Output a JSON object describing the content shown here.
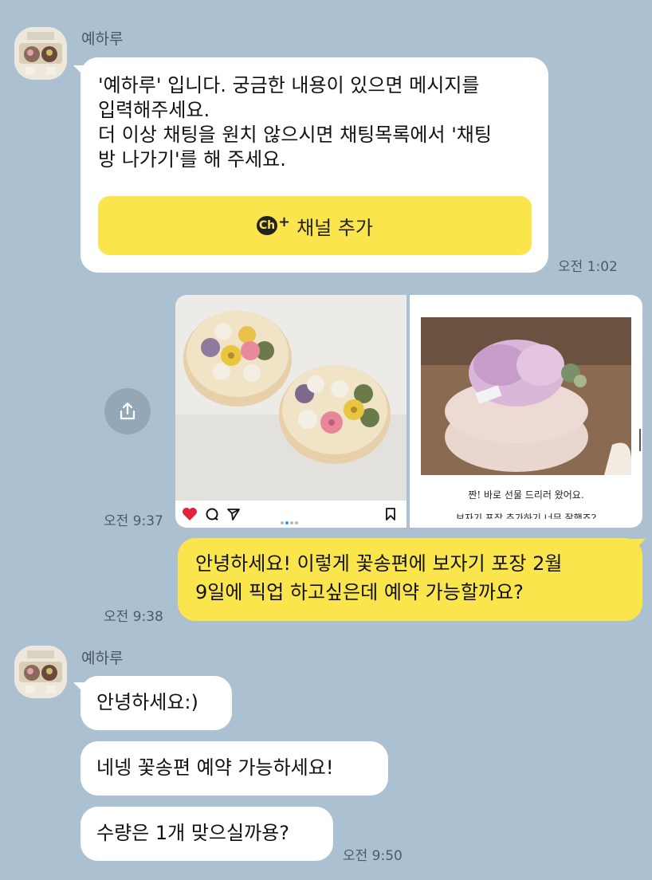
{
  "chat": {
    "sender_name": "예하루",
    "msg1": {
      "line1": "'예하루' 입니다.  궁금한 내용이 있으면 메시지를",
      "line2": "입력해주세요.",
      "line3": "더 이상 채팅을 원치 않으시면 채팅목록에서 '채팅",
      "line4": "방 나가기'를 해 주세요.",
      "button_label": "채널 추가",
      "button_icon_text": "Ch",
      "time": "오전 1:02"
    },
    "shared_post": {
      "time": "오전 9:37",
      "caption_line1": "짠! 바로 선물 드리러 왔어요.",
      "caption_line2": "보자기 포장 추가하기 너무 잘했죠?"
    },
    "msg2": {
      "line1": "안녕하세요! 이렇게 꽃송편에 보자기 포장 2월",
      "line2": "9일에 픽업 하고싶은데 예약 가능할까요?",
      "time": "오전 9:38"
    },
    "msg3": "안녕하세요:)",
    "msg4": "네넹 꽃송편 예약 가능하세요!",
    "msg5": "수량은 1개 맞으실까용?",
    "msg5_time": "오전 9:50"
  },
  "colors": {
    "background": "#abc1d1",
    "my_bubble": "#fae54d",
    "their_bubble": "#ffffff",
    "channel_button": "#fae54d"
  },
  "icons": [
    "avatar-rice-cake",
    "channel-icon",
    "share-icon",
    "heart-icon",
    "comment-icon",
    "send-icon",
    "bookmark-icon"
  ]
}
